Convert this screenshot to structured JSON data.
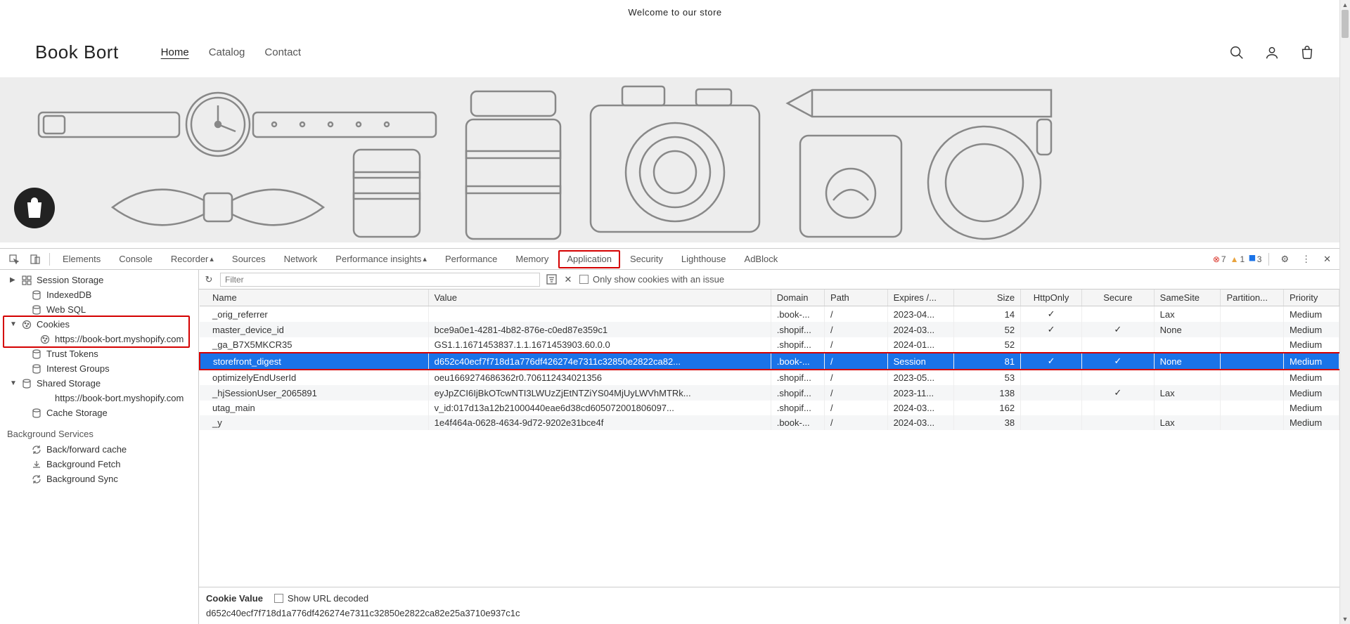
{
  "site": {
    "announcement": "Welcome to our store",
    "logo": "Book Bort",
    "nav": [
      {
        "label": "Home",
        "active": true
      },
      {
        "label": "Catalog",
        "active": false
      },
      {
        "label": "Contact",
        "active": false
      }
    ]
  },
  "devtools": {
    "tabs": [
      "Elements",
      "Console",
      "Recorder",
      "Sources",
      "Network",
      "Performance insights",
      "Performance",
      "Memory",
      "Application",
      "Security",
      "Lighthouse",
      "AdBlock"
    ],
    "activeTab": "Application",
    "badges": {
      "errors": "7",
      "warnings": "1",
      "info": "3"
    },
    "sidebar": {
      "items": [
        {
          "label": "Session Storage",
          "icon": "grid",
          "arrow": "▶",
          "lvl": 1
        },
        {
          "label": "IndexedDB",
          "icon": "db",
          "lvl": 2
        },
        {
          "label": "Web SQL",
          "icon": "db",
          "lvl": 2
        },
        {
          "label": "Cookies",
          "icon": "cookie",
          "arrow": "▼",
          "lvl": 1,
          "highlight": true
        },
        {
          "label": "https://book-bort.myshopify.com",
          "icon": "cookie",
          "lvl": 3,
          "highlight": true
        },
        {
          "label": "Trust Tokens",
          "icon": "db",
          "lvl": 2
        },
        {
          "label": "Interest Groups",
          "icon": "db",
          "lvl": 2
        },
        {
          "label": "Shared Storage",
          "icon": "db",
          "arrow": "▼",
          "lvl": 1
        },
        {
          "label": "https://book-bort.myshopify.com",
          "icon": "",
          "lvl": 3
        },
        {
          "label": "Cache Storage",
          "icon": "db",
          "lvl": 2
        }
      ],
      "heading": "Background Services",
      "bgItems": [
        {
          "label": "Back/forward cache",
          "icon": "sync"
        },
        {
          "label": "Background Fetch",
          "icon": "fetch"
        },
        {
          "label": "Background Sync",
          "icon": "sync"
        }
      ]
    },
    "toolbar": {
      "filterPlaceholder": "Filter",
      "onlyIssues": "Only show cookies with an issue"
    },
    "columns": [
      "Name",
      "Value",
      "Domain",
      "Path",
      "Expires /...",
      "Size",
      "HttpOnly",
      "Secure",
      "SameSite",
      "Partition...",
      "Priority"
    ],
    "rows": [
      {
        "name": "_orig_referrer",
        "value": "",
        "domain": ".book-...",
        "path": "/",
        "expires": "2023-04...",
        "size": "14",
        "http": "✓",
        "secure": "",
        "same": "Lax",
        "part": "",
        "prio": "Medium"
      },
      {
        "name": "master_device_id",
        "value": "bce9a0e1-4281-4b82-876e-c0ed87e359c1",
        "domain": ".shopif...",
        "path": "/",
        "expires": "2024-03...",
        "size": "52",
        "http": "✓",
        "secure": "✓",
        "same": "None",
        "part": "",
        "prio": "Medium"
      },
      {
        "name": "_ga_B7X5MKCR35",
        "value": "GS1.1.1671453837.1.1.1671453903.60.0.0",
        "domain": ".shopif...",
        "path": "/",
        "expires": "2024-01...",
        "size": "52",
        "http": "",
        "secure": "",
        "same": "",
        "part": "",
        "prio": "Medium"
      },
      {
        "name": "storefront_digest",
        "value": "d652c40ecf7f718d1a776df426274e7311c32850e2822ca82...",
        "domain": ".book-...",
        "path": "/",
        "expires": "Session",
        "size": "81",
        "http": "✓",
        "secure": "✓",
        "same": "None",
        "part": "",
        "prio": "Medium",
        "selected": true
      },
      {
        "name": "optimizelyEndUserId",
        "value": "oeu1669274686362r0.706112434021356",
        "domain": ".shopif...",
        "path": "/",
        "expires": "2023-05...",
        "size": "53",
        "http": "",
        "secure": "",
        "same": "",
        "part": "",
        "prio": "Medium"
      },
      {
        "name": "_hjSessionUser_2065891",
        "value": "eyJpZCI6IjBkOTcwNTI3LWUzZjEtNTZiYS04MjUyLWVhMTRk...",
        "domain": ".shopif...",
        "path": "/",
        "expires": "2023-11...",
        "size": "138",
        "http": "",
        "secure": "✓",
        "same": "Lax",
        "part": "",
        "prio": "Medium"
      },
      {
        "name": "utag_main",
        "value": "v_id:017d13a12b21000440eae6d38cd605072001806097...",
        "domain": ".shopif...",
        "path": "/",
        "expires": "2024-03...",
        "size": "162",
        "http": "",
        "secure": "",
        "same": "",
        "part": "",
        "prio": "Medium"
      },
      {
        "name": "_y",
        "value": "1e4f464a-0628-4634-9d72-9202e31bce4f",
        "domain": ".book-...",
        "path": "/",
        "expires": "2024-03...",
        "size": "38",
        "http": "",
        "secure": "",
        "same": "Lax",
        "part": "",
        "prio": "Medium"
      }
    ],
    "cookieDetail": {
      "label": "Cookie Value",
      "decoded": "Show URL decoded",
      "value": "d652c40ecf7f718d1a776df426274e7311c32850e2822ca82e25a3710e937c1c"
    }
  }
}
